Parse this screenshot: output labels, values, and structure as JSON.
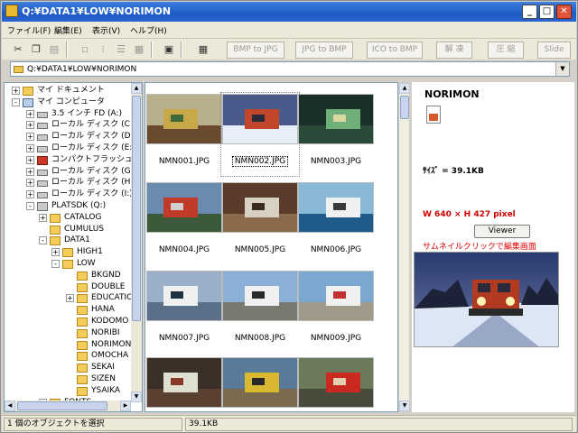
{
  "window": {
    "title": "Q:¥DATA1¥LOW¥NORIMON",
    "minimize": "_",
    "maximize": "□",
    "close": "✕"
  },
  "menu": [
    "ファイル(F)",
    "編集(E)",
    "表示(V)",
    "ヘルプ(H)"
  ],
  "toolbar": {
    "icons": [
      "cut-icon",
      "copy-icon",
      "paste-icon",
      "large-icons-view-icon",
      "small-icons-view-icon",
      "list-view-icon",
      "details-view-icon",
      "up-folder-icon",
      "thumbnail-view-icon"
    ],
    "bmp_to_jpg": "BMP to JPG",
    "jpg_to_bmp": "JPG to BMP",
    "ico_to_bmp": "ICO to BMP",
    "unzip": "解 凍",
    "compress": "圧 縮",
    "slide": "Slide"
  },
  "address": {
    "path": "Q:¥DATA1¥LOW¥NORIMON"
  },
  "tree": [
    {
      "label": "マイ ドキュメント",
      "icon": "folder",
      "level": 1,
      "exp": "+"
    },
    {
      "label": "マイ コンピュータ",
      "icon": "pc",
      "level": 1,
      "exp": "-"
    },
    {
      "label": "3.5 インチ FD (A:)",
      "icon": "drive",
      "level": 2,
      "exp": "+"
    },
    {
      "label": "ローカル ディスク (C:)",
      "icon": "drive",
      "level": 2,
      "exp": "+"
    },
    {
      "label": "ローカル ディスク (D:)",
      "icon": "drive",
      "level": 2,
      "exp": "+"
    },
    {
      "label": "ローカル ディスク (E:)",
      "icon": "drive",
      "level": 2,
      "exp": "+"
    },
    {
      "label": "コンパクトフラッシュ リーダー",
      "icon": "flash",
      "level": 2,
      "exp": "+"
    },
    {
      "label": "ローカル ディスク (G:)",
      "icon": "drive",
      "level": 2,
      "exp": "+"
    },
    {
      "label": "ローカル ディスク (H:)",
      "icon": "drive",
      "level": 2,
      "exp": "+"
    },
    {
      "label": "ローカル ディスク (I:)",
      "icon": "drive",
      "level": 2,
      "exp": "+"
    },
    {
      "label": "PLATSDK (Q:)",
      "icon": "net",
      "level": 2,
      "exp": "-"
    },
    {
      "label": "CATALOG",
      "icon": "folder",
      "level": 3,
      "exp": "+"
    },
    {
      "label": "CUMULUS",
      "icon": "folder",
      "level": 3,
      "exp": ""
    },
    {
      "label": "DATA1",
      "icon": "folder",
      "level": 3,
      "exp": "-"
    },
    {
      "label": "HIGH1",
      "icon": "folder",
      "level": 4,
      "exp": "+"
    },
    {
      "label": "LOW",
      "icon": "folder",
      "level": 4,
      "exp": "-"
    },
    {
      "label": "BKGND",
      "icon": "folder",
      "level": 5,
      "exp": ""
    },
    {
      "label": "DOUBLE",
      "icon": "folder",
      "level": 5,
      "exp": ""
    },
    {
      "label": "EDUCATION",
      "icon": "folder",
      "level": 5,
      "exp": "+"
    },
    {
      "label": "HANA",
      "icon": "folder",
      "level": 5,
      "exp": ""
    },
    {
      "label": "KODOMO",
      "icon": "folder",
      "level": 5,
      "exp": ""
    },
    {
      "label": "NORIBI",
      "icon": "folder",
      "level": 5,
      "exp": ""
    },
    {
      "label": "NORIMON",
      "icon": "folder",
      "level": 5,
      "exp": ""
    },
    {
      "label": "OMOCHA",
      "icon": "folder",
      "level": 5,
      "exp": ""
    },
    {
      "label": "SEKAI",
      "icon": "folder",
      "level": 5,
      "exp": ""
    },
    {
      "label": "SIZEN",
      "icon": "folder",
      "level": 5,
      "exp": ""
    },
    {
      "label": "YSAIKA",
      "icon": "folder",
      "level": 5,
      "exp": ""
    },
    {
      "label": "FONTS",
      "icon": "folder",
      "level": 3,
      "exp": "+"
    }
  ],
  "thumbnails": [
    {
      "name": "NMN001.JPG",
      "scene": "Yellow and green train cars at a station platform",
      "sky": "#b8b08c",
      "ground": "#6a4a2c",
      "accent": "#c9a84a",
      "accent2": "#3e6a3a"
    },
    {
      "name": "NMN002.JPG",
      "scene": "Red diesel locomotive on a snowy track at dusk",
      "sky": "#4a5a8a",
      "ground": "#e8eef8",
      "accent": "#c2462a",
      "accent2": "#2a2a3a"
    },
    {
      "name": "NMN003.JPG",
      "scene": "Freight trains at a night yard",
      "sky": "#1a2e2a",
      "ground": "#2a4a3a",
      "accent": "#6fb07a",
      "accent2": "#d8d8a0"
    },
    {
      "name": "NMN004.JPG",
      "scene": "Tractor at a lakeside work site",
      "sky": "#6a8ab0",
      "ground": "#3a5a3a",
      "accent": "#c03a2a",
      "accent2": "#d0d0d0"
    },
    {
      "name": "NMN005.JPG",
      "scene": "Toy vehicles on a wooden table",
      "sky": "#5a3a2a",
      "ground": "#8a6a4a",
      "accent": "#d8d0c0",
      "accent2": "#3a2a20"
    },
    {
      "name": "NMN006.JPG",
      "scene": "White boat on blue water",
      "sky": "#8ab8d8",
      "ground": "#1e5a8a",
      "accent": "#f0f0f0",
      "accent2": "#3a3a3a"
    },
    {
      "name": "NMN007.JPG",
      "scene": "Fishing boats at a harbor",
      "sky": "#9ab0c8",
      "ground": "#5a7088",
      "accent": "#f0f0f0",
      "accent2": "#203040"
    },
    {
      "name": "NMN008.JPG",
      "scene": "Police car on a paved road",
      "sky": "#8ab0d8",
      "ground": "#7a7a70",
      "accent": "#f0f0f0",
      "accent2": "#2a2a2a"
    },
    {
      "name": "NMN009.JPG",
      "scene": "White car parked outside a building",
      "sky": "#7aa8d0",
      "ground": "#a09a8a",
      "accent": "#f0f0f0",
      "accent2": "#c03030"
    },
    {
      "name": "",
      "scene": "Street with trucks and people",
      "sky": "#3a3028",
      "ground": "#5a4030",
      "accent": "#e0e0d0",
      "accent2": "#8a3a2a"
    },
    {
      "name": "",
      "scene": "Yellow three-wheeled truck",
      "sky": "#5a7a9a",
      "ground": "#7a6a50",
      "accent": "#d8b830",
      "accent2": "#2a2a2a"
    },
    {
      "name": "",
      "scene": "Red vintage car with a person",
      "sky": "#6a7a5a",
      "ground": "#4a4a3a",
      "accent": "#c82a20",
      "accent2": "#e0d0b0"
    }
  ],
  "selected_index": 1,
  "details": {
    "name": "NORIMON",
    "size": "ｻｲｽﾞ = 39.1KB",
    "dims": "W 640 × H 427 pixel",
    "viewer": "Viewer",
    "hint": "サムネイルクリックで編集画面",
    "preview_scene": "Red diesel locomotive with headlights on in snow at dusk"
  },
  "status": {
    "selection": "1 個のオブジェクトを選択",
    "size": "39.1KB"
  },
  "colors": {
    "titlebar": "#2a63cf",
    "dims_text": "#d00000",
    "hint_text": "#e00000"
  }
}
